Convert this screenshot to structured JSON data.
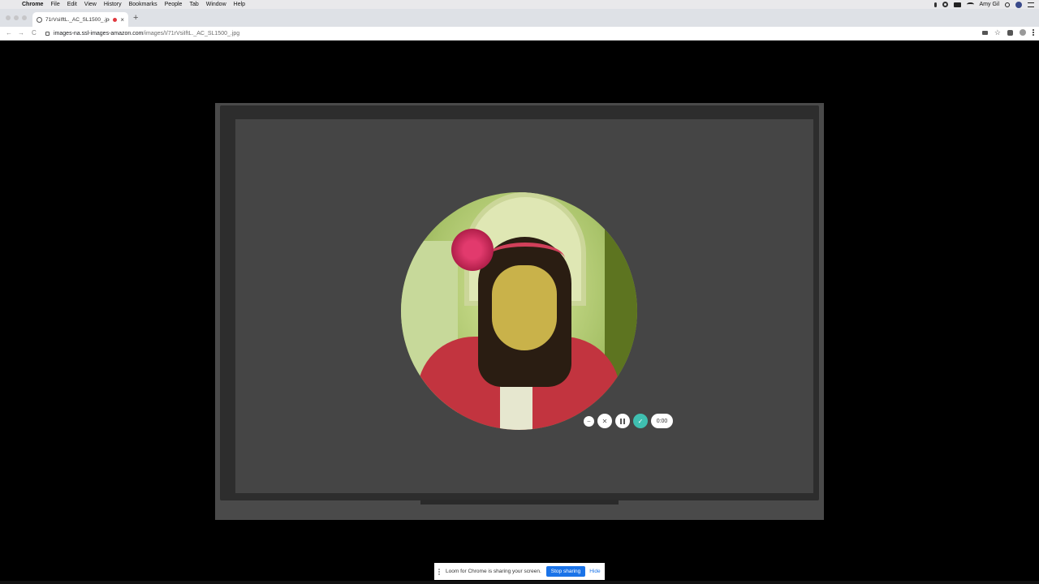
{
  "menubar": {
    "app": "Chrome",
    "items": [
      "File",
      "Edit",
      "View",
      "History",
      "Bookmarks",
      "People",
      "Tab",
      "Window",
      "Help"
    ],
    "user": "Amy Gil",
    "status_icons": [
      "mic-icon",
      "brightness-icon",
      "screen-mirror-icon",
      "wifi-icon",
      "spotlight-search-icon",
      "user-avatar-icon",
      "control-center-icon"
    ]
  },
  "tab": {
    "title": "71rVsiIftL._AC_SL1500_.jpg",
    "close": "×",
    "new_tab": "+"
  },
  "toolbar": {
    "back": "←",
    "forward": "→",
    "reload": "C",
    "url_host": "images-na.ssl-images-amazon.com",
    "url_path": "/images/I/71rVsiIftL._AC_SL1500_.jpg",
    "bookmark": "☆"
  },
  "recorder": {
    "timer": "0:00",
    "minimize": "–",
    "cancel": "✕",
    "done": "✓"
  },
  "share_bar": {
    "message": "Loom for Chrome is sharing your screen.",
    "stop_label": "Stop sharing",
    "hide_label": "Hide"
  },
  "colors": {
    "menubar_bg": "#e9e9eb",
    "tabstrip_bg": "#dee1e6",
    "recording_red": "#e0383e",
    "loom_teal": "#3fbfb0",
    "chrome_blue": "#1a73e8"
  }
}
